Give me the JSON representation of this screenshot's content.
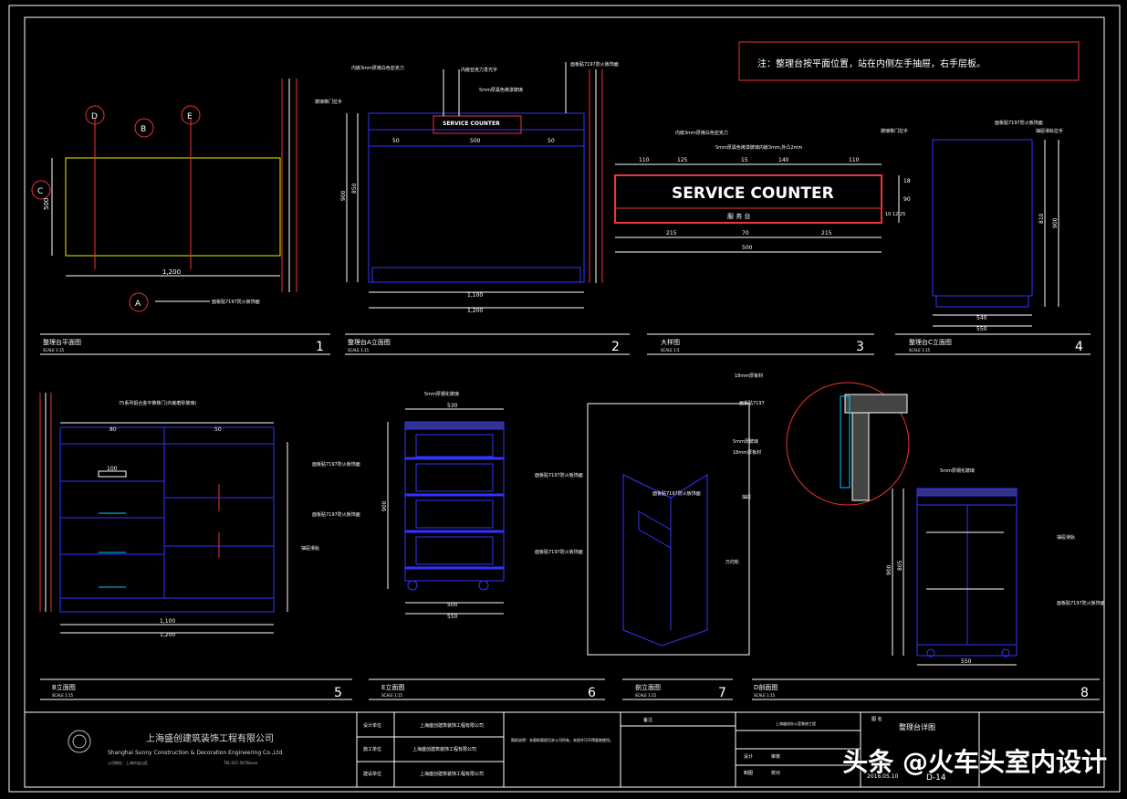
{
  "note": "注：整理台按平面位置，站在内侧左手抽屉，右手层板。",
  "panels": [
    {
      "title": "整理台平面图",
      "scale": "SCALE 1:15",
      "num": "1"
    },
    {
      "title": "整理台A立面图",
      "scale": "SCALE 1:15",
      "num": "2"
    },
    {
      "title": "大样图",
      "scale": "SCALE 1:5",
      "num": "3"
    },
    {
      "title": "整理台C立面图",
      "scale": "SCALE 1:15",
      "num": "4"
    },
    {
      "title": "B立面图",
      "scale": "SCALE 1:15",
      "num": "5"
    },
    {
      "title": "E立面图",
      "scale": "SCALE 1:15",
      "num": "6"
    },
    {
      "title": "剖立面图",
      "scale": "SCALE 1:15",
      "num": "7"
    },
    {
      "title": "D剖面图",
      "scale": "SCALE 1:15",
      "num": "8"
    }
  ],
  "sign": {
    "main": "SERVICE COUNTER",
    "sub": "服 务 台"
  },
  "dims": {
    "p1": {
      "w": "1,200",
      "h": "500"
    },
    "p2": {
      "a": "50",
      "b": "500",
      "c": "50",
      "w1": "1,100",
      "w2": "1,200",
      "h": "900",
      "h2": "850"
    },
    "p3": {
      "d1": "110",
      "d2": "125",
      "d3": "15",
      "d4": "140",
      "d5": "110",
      "b1": "215",
      "b2": "70",
      "b3": "215",
      "total": "500",
      "r1": "18",
      "r2": "90",
      "r3": "10 12 25"
    },
    "p4": {
      "w1": "540",
      "w2": "550",
      "h": "900",
      "h2": "810"
    },
    "p5": {
      "a": "80",
      "b": "50",
      "d": "100",
      "w1": "1,100",
      "w2": "1,200"
    },
    "p6": {
      "w1": "500",
      "w2": "550",
      "top": "530",
      "h": "900"
    },
    "p8": {
      "w": "550",
      "h": "900",
      "h2": "805"
    }
  },
  "annotations": {
    "p1": "面板贴7197防火板饰面",
    "p2": [
      "内嵌3mm厚烤白色亚克力",
      "内嵌亚克力发光字",
      "5mm厚黑色烤漆玻璃",
      "面板贴7197防火板饰面",
      "玻璃移门拉手"
    ],
    "p3": [
      "内嵌3mm厚烤白色亚克力",
      "5mm厚黑色烤漆玻璃内嵌3mm,外凸2mm"
    ],
    "p4": [
      "面板贴7197防火板饰面",
      "玻璃移门拉手",
      "抽屉滑轨拉手"
    ],
    "p5": [
      "75系列铝合金平推移门(内嵌磨砂玻璃)",
      "面板贴7197防火板饰面",
      "面板贴7197防火板饰面",
      "抽屉滑轨"
    ],
    "p6": [
      "5mm厚钢化玻璃",
      "面板贴7197防火板饰面",
      "面板贴7197防火板饰面"
    ],
    "p7": [
      "面板贴7197防火板饰面",
      "万向轮"
    ],
    "p8": [
      "18mm厚板材",
      "面板贴7197",
      "5mm厚玻璃",
      "18mm厚板材",
      "抽屉",
      "5mm厚钢化玻璃",
      "抽屉滑轨",
      "面板贴7197防火板饰面"
    ]
  },
  "titleblock": {
    "company_cn": "上海盛创建筑装饰工程有限公司",
    "company_en": "Shanghai Sunny Construction & Decoration Engineering Co.,Ltd.",
    "addr": "公司地址：上海市宝山区",
    "tel": "TEL:021-5678xxxx",
    "rows": [
      {
        "label": "设计单位",
        "value": "上海盛创建筑装饰工程有限公司"
      },
      {
        "label": "施工单位",
        "value": "上海盛创建筑装饰工程有限公司"
      },
      {
        "label": "建设单位",
        "value": "上海盛创建筑装饰工程有限公司"
      }
    ],
    "notes": "图纸说明：本图纸版权归本公司所有，未经许可不得复制使用。",
    "col_label": "备注",
    "project": "上海盛创办公室装修工程",
    "drawing_name_label": "图 名",
    "drawing_name": "整理台详图",
    "date": "2016.05.10",
    "drawing_no": "D-14",
    "sig": [
      "设计",
      "审核",
      "制图",
      "校对"
    ]
  },
  "watermark": "头条 @火车头室内设计"
}
